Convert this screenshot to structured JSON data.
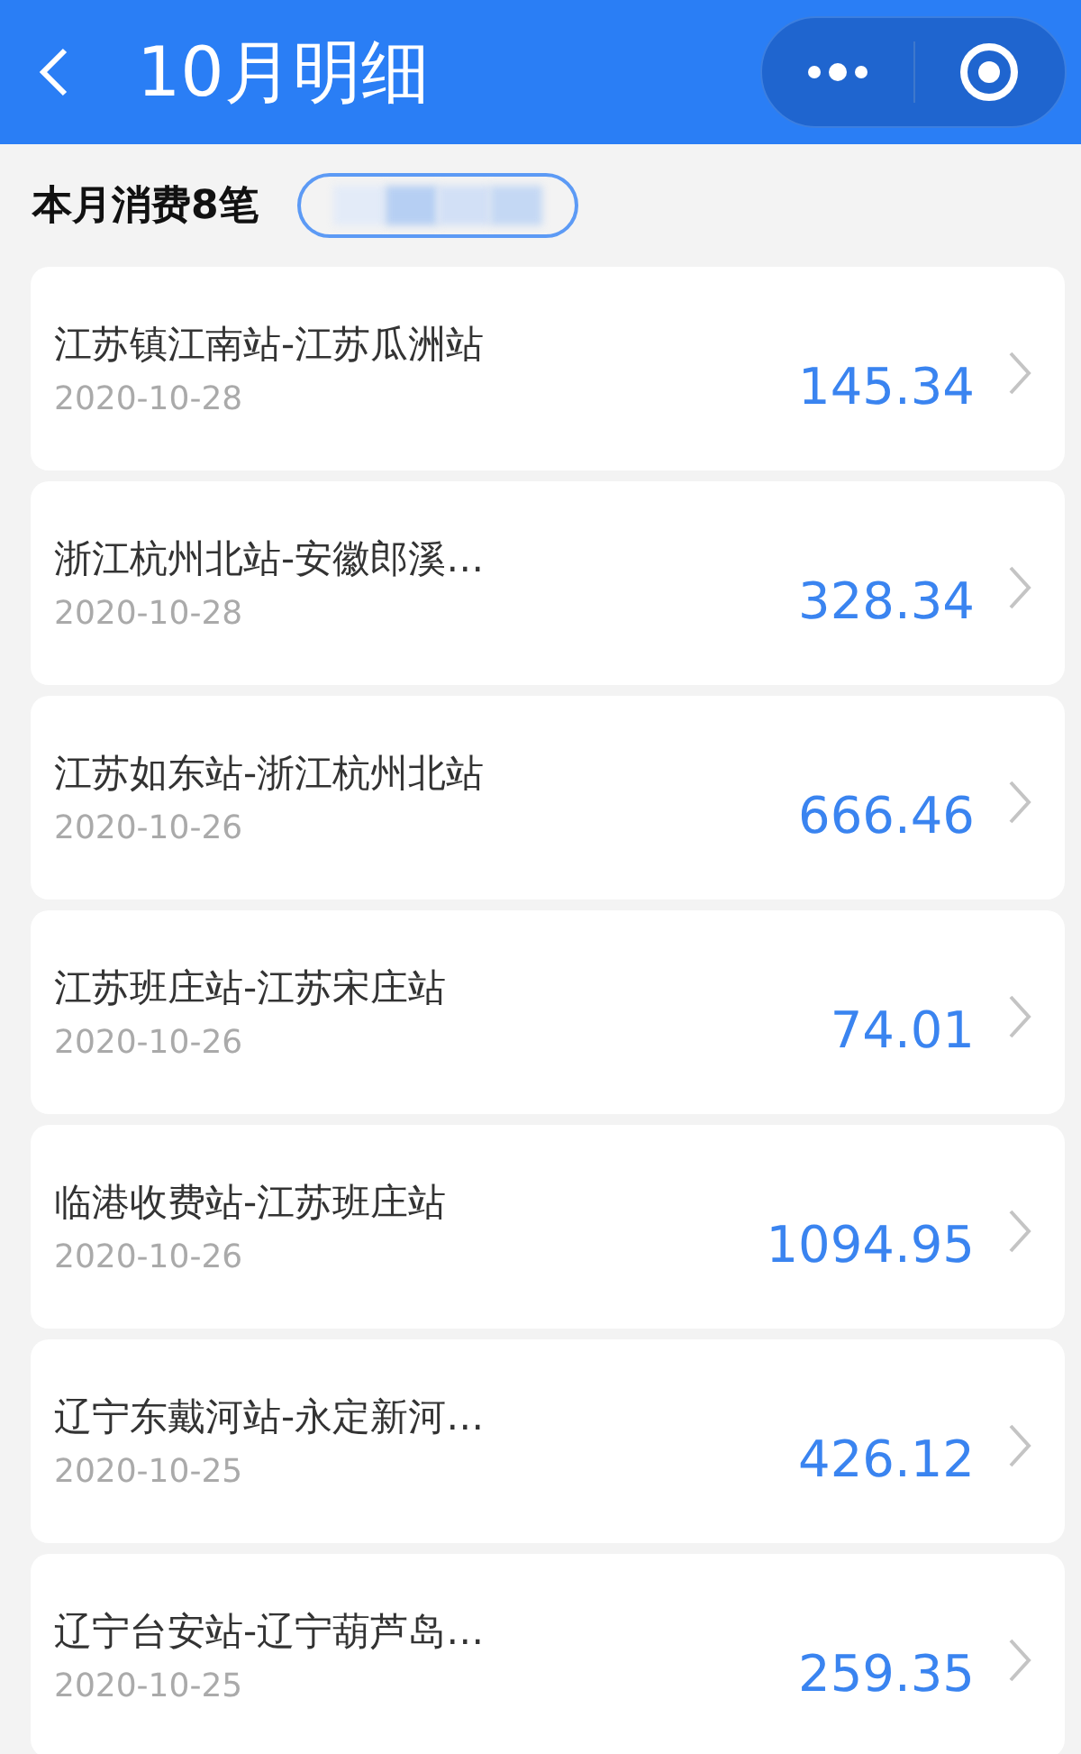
{
  "header": {
    "title": "10月明细"
  },
  "summary": {
    "label": "本月消费8笔"
  },
  "records": [
    {
      "route": "江苏镇江南站-江苏瓜洲站",
      "date": "2020-10-28",
      "amount": "145.34"
    },
    {
      "route": "浙江杭州北站-安徽郎溪…",
      "date": "2020-10-28",
      "amount": "328.34"
    },
    {
      "route": "江苏如东站-浙江杭州北站",
      "date": "2020-10-26",
      "amount": "666.46"
    },
    {
      "route": "江苏班庄站-江苏宋庄站",
      "date": "2020-10-26",
      "amount": "74.01"
    },
    {
      "route": "临港收费站-江苏班庄站",
      "date": "2020-10-26",
      "amount": "1094.95"
    },
    {
      "route": "辽宁东戴河站-永定新河…",
      "date": "2020-10-25",
      "amount": "426.12"
    },
    {
      "route": "辽宁台安站-辽宁葫芦岛…",
      "date": "2020-10-25",
      "amount": "259.35"
    }
  ]
}
